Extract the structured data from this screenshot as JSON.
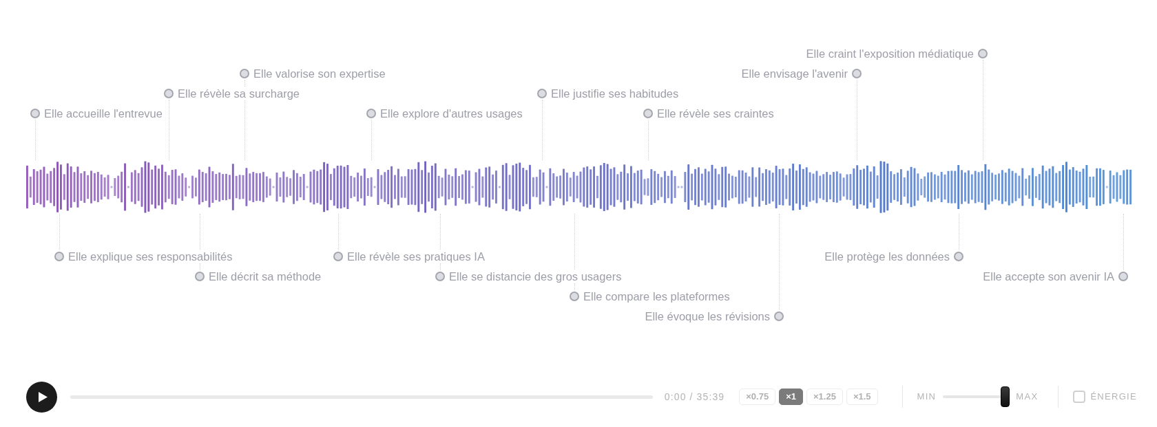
{
  "markers": [
    {
      "text": "Elle craint l'exposition médiatique"
    },
    {
      "text": "Elle valorise son expertise"
    },
    {
      "text": "Elle envisage l'avenir"
    },
    {
      "text": "Elle révèle sa surcharge"
    },
    {
      "text": "Elle justifie ses habitudes"
    },
    {
      "text": "Elle accueille l'entrevue"
    },
    {
      "text": "Elle explore d'autres usages"
    },
    {
      "text": "Elle révèle ses craintes"
    },
    {
      "text": "Elle explique ses responsabilités"
    },
    {
      "text": "Elle révèle ses pratiques IA"
    },
    {
      "text": "Elle protège les données"
    },
    {
      "text": "Elle décrit sa méthode"
    },
    {
      "text": "Elle se distancie des gros usagers"
    },
    {
      "text": "Elle accepte son avenir IA"
    },
    {
      "text": "Elle compare les plateformes"
    },
    {
      "text": "Elle évoque les révisions"
    }
  ],
  "player": {
    "playing": false,
    "progress": {
      "level": 0
    },
    "time": "0:00 / 35:39",
    "speeds": [
      {
        "label": "×0.75",
        "selected": false
      },
      {
        "label": "×1",
        "selected": true
      },
      {
        "label": "×1.25",
        "selected": false
      },
      {
        "label": "×1.5",
        "selected": false
      }
    ],
    "slider": {
      "min_label": "MIN",
      "max_label": "MAX",
      "level": 1
    },
    "energy": {
      "label": "ÉNERGIE",
      "checked": false
    }
  }
}
